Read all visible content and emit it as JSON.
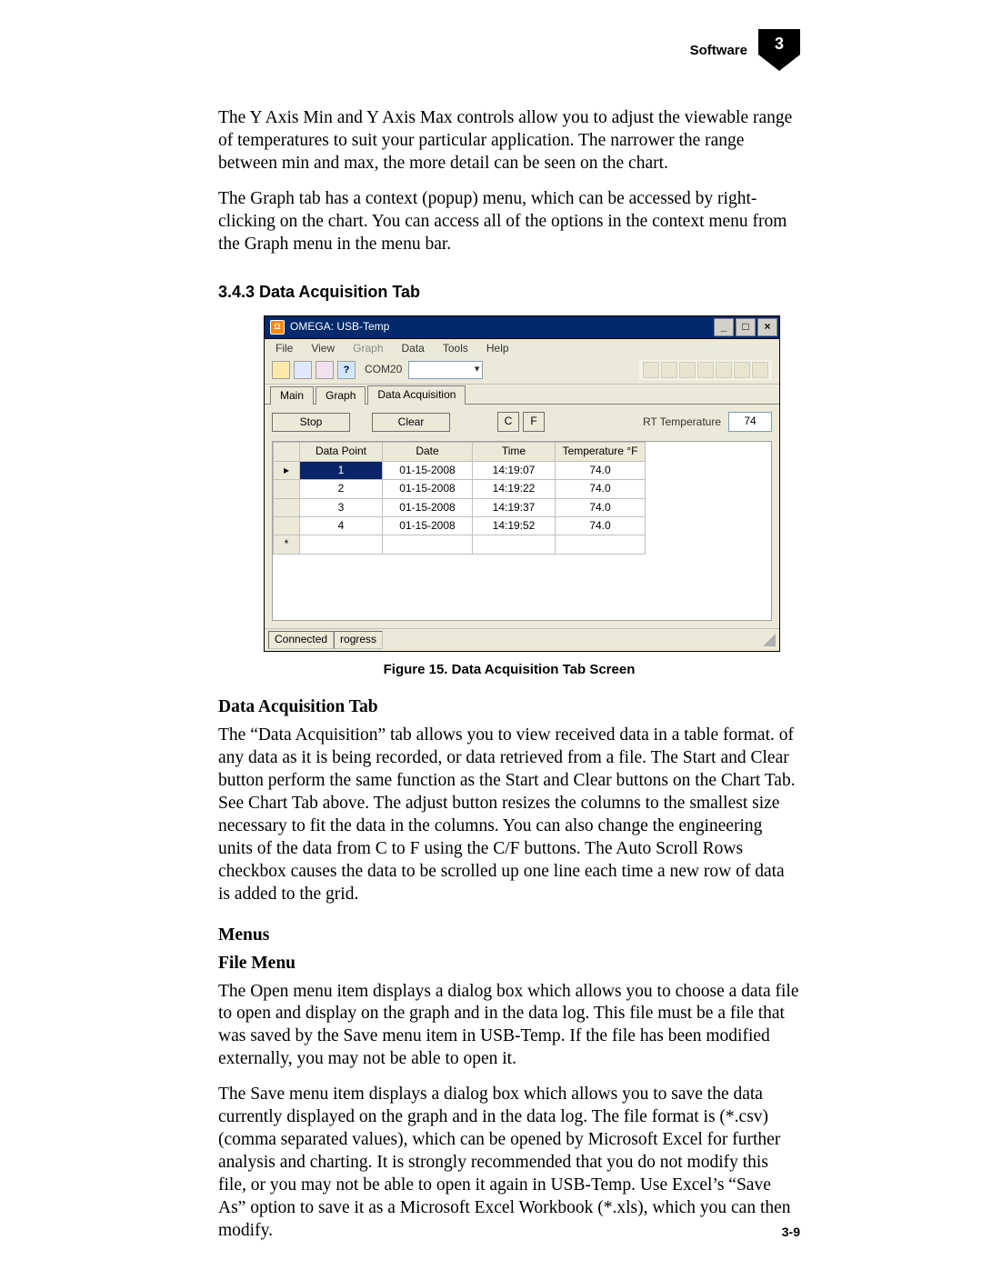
{
  "page_header": {
    "section_label": "Software",
    "section_number": "3"
  },
  "footer": {
    "page_number": "3-9"
  },
  "paragraphs": {
    "p1": "The Y Axis Min and Y Axis Max controls allow you to adjust the viewable range of temperatures to suit your particular application.  The narrower the range between min and max, the more detail can be seen on the chart.",
    "p2": "The Graph tab has a context (popup) menu, which can be accessed by right-clicking on the chart.  You can access all of the options in the context menu from the Graph menu in the menu bar.",
    "p3": "The “Data Acquisition” tab allows you to view received data in a table format. of any data as it is being recorded, or data retrieved from a file.  The Start and Clear button perform the same function as the Start and Clear buttons on the Chart Tab.  See Chart Tab above.  The adjust button resizes the columns to the smallest size necessary to fit the data in the columns.  You can also change the engineering units of the data from C to F using the C/F buttons.  The Auto Scroll Rows checkbox causes the data to be scrolled up one line each time a new row of data is added to the grid.",
    "p4": "The Open menu item displays a dialog box which allows you to choose a data file to open and display on the graph and in the data log.  This file must be a file that was saved by the Save menu item in USB-Temp.  If the file has been modified externally, you may not be able to open it.",
    "p5": "The Save menu item displays a dialog box which allows you to save the data currently displayed on the graph and in the data log.  The file format is (*.csv) (comma separated values), which can be opened by Microsoft Excel for further analysis and charting.  It is strongly recommended that you do not modify this file, or you may not be able to open it again in USB-Temp.  Use Excel’s “Save As” option to save it as a Microsoft Excel Workbook (*.xls), which you can then modify."
  },
  "headings": {
    "h343": "3.4.3 Data Acquisition Tab",
    "fig_caption": "Figure 15.  Data Acquisition Tab Screen",
    "daq_tab": "Data Acquisition Tab",
    "menus": "Menus",
    "file_menu": "File Menu"
  },
  "screenshot": {
    "title": "OMEGA: USB-Temp",
    "window_buttons": {
      "min": "_",
      "max": "□",
      "close": "×"
    },
    "menu_items": [
      "File",
      "View",
      "Graph",
      "Data",
      "Tools",
      "Help"
    ],
    "menu_disabled_index": 2,
    "toolbar": {
      "com_label": "COM20"
    },
    "tabs": [
      "Main",
      "Graph",
      "Data Acquisition"
    ],
    "active_tab_index": 2,
    "buttons": {
      "stop": "Stop",
      "clear": "Clear",
      "c": "C",
      "f": "F"
    },
    "rt_label": "RT Temperature",
    "rt_value": "74",
    "columns": [
      "Data Point",
      "Date",
      "Time",
      "Temperature °F"
    ],
    "rows": [
      {
        "marker": "▸",
        "point": "1",
        "date": "01-15-2008",
        "time": "14:19:07",
        "temp": "74.0",
        "selected": true
      },
      {
        "marker": "",
        "point": "2",
        "date": "01-15-2008",
        "time": "14:19:22",
        "temp": "74.0",
        "selected": false
      },
      {
        "marker": "",
        "point": "3",
        "date": "01-15-2008",
        "time": "14:19:37",
        "temp": "74.0",
        "selected": false
      },
      {
        "marker": "",
        "point": "4",
        "date": "01-15-2008",
        "time": "14:19:52",
        "temp": "74.0",
        "selected": false
      },
      {
        "marker": "*",
        "point": "",
        "date": "",
        "time": "",
        "temp": "",
        "selected": false
      }
    ],
    "status": {
      "connected": "Connected",
      "progress": "rogress"
    }
  }
}
